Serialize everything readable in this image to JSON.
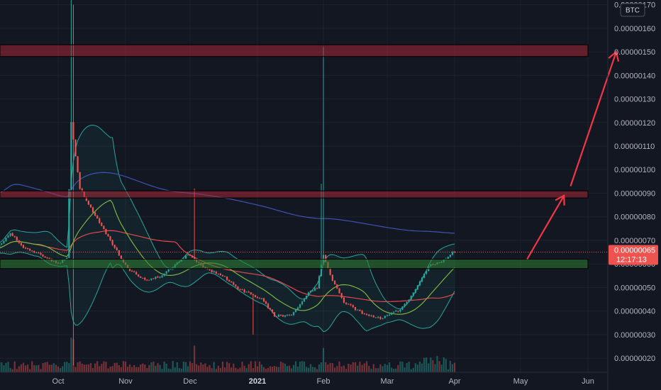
{
  "chart_data": {
    "type": "candlestick",
    "currency": "BTC",
    "y_axis": {
      "range": [
        1.4e-07,
        1.72e-06
      ],
      "ticks": [
        "0.00000020",
        "0.00000030",
        "0.00000040",
        "0.00000050",
        "0.00000060",
        "0.00000070",
        "0.00000080",
        "0.00000090",
        "0.00000100",
        "0.00000110",
        "0.00000120",
        "0.00000130",
        "0.00000140",
        "0.00000150",
        "0.00000160",
        "0.00000170"
      ]
    },
    "x_axis": {
      "ticks": [
        {
          "label": "Oct",
          "bold": false
        },
        {
          "label": "Nov",
          "bold": false
        },
        {
          "label": "Dec",
          "bold": false
        },
        {
          "label": "2021",
          "bold": true
        },
        {
          "label": "Feb",
          "bold": false
        },
        {
          "label": "Mar",
          "bold": false
        },
        {
          "label": "Apr",
          "bold": false
        },
        {
          "label": "May",
          "bold": false
        },
        {
          "label": "Jun",
          "bold": false
        }
      ]
    },
    "current_price": {
      "value": "0.00000065",
      "countdown": "12:17:13",
      "level": 6.5e-07
    },
    "zones": [
      {
        "kind": "resistance",
        "low": 1.48e-06,
        "high": 1.53e-06,
        "color": "#b22833"
      },
      {
        "kind": "resistance",
        "low": 8.8e-07,
        "high": 9.1e-07,
        "color": "#b22833"
      },
      {
        "kind": "support",
        "low": 5.8e-07,
        "high": 6.2e-07,
        "color": "#2e7d32"
      }
    ],
    "projection": [
      {
        "from_day": 245,
        "from_price": 6.2e-07,
        "to_day": 262,
        "to_price": 8.9e-07
      },
      {
        "from_day": 265,
        "from_price": 9.3e-07,
        "to_day": 286,
        "to_price": 1.5e-06
      }
    ],
    "colors": {
      "up": "#26a69a",
      "down": "#ef5350",
      "ma_red": "#e04a4a",
      "ma_green": "#7cb342",
      "ma_blue": "#3f51b5",
      "band": "#26a69a"
    }
  }
}
